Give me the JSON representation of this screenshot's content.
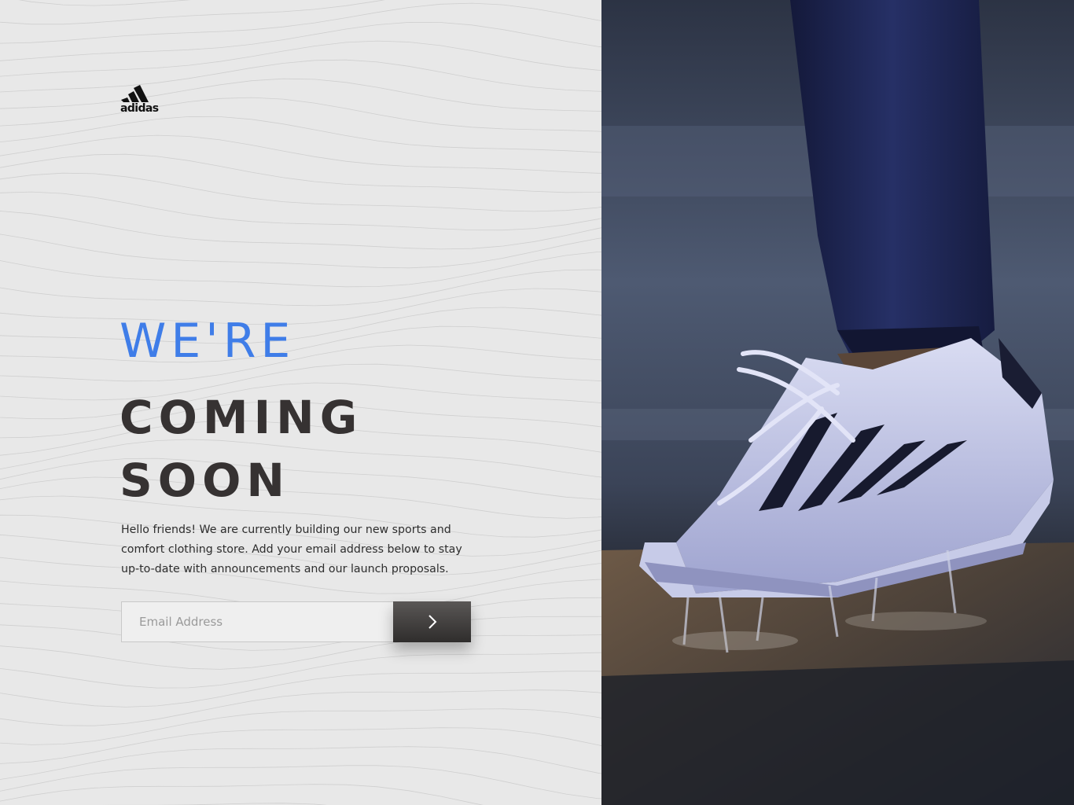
{
  "brand": {
    "logo_text": "adidas"
  },
  "hero": {
    "line1": "WE'RE",
    "line2": "COMING",
    "line3": "SOON",
    "intro": "Hello friends! We are currently building our new sports and comfort clothing store. Add your email address below to stay up-to-date with announcements and our launch proposals."
  },
  "signup": {
    "email_value": "",
    "email_placeholder": "Email Address"
  },
  "colors": {
    "accent": "#3f7de8",
    "heading": "#363232",
    "button": "#3a3837",
    "left_background": "#e8e8e8"
  },
  "icons": {
    "logo": "adidas-three-stripes-logo",
    "submit": "chevron-right-icon"
  }
}
